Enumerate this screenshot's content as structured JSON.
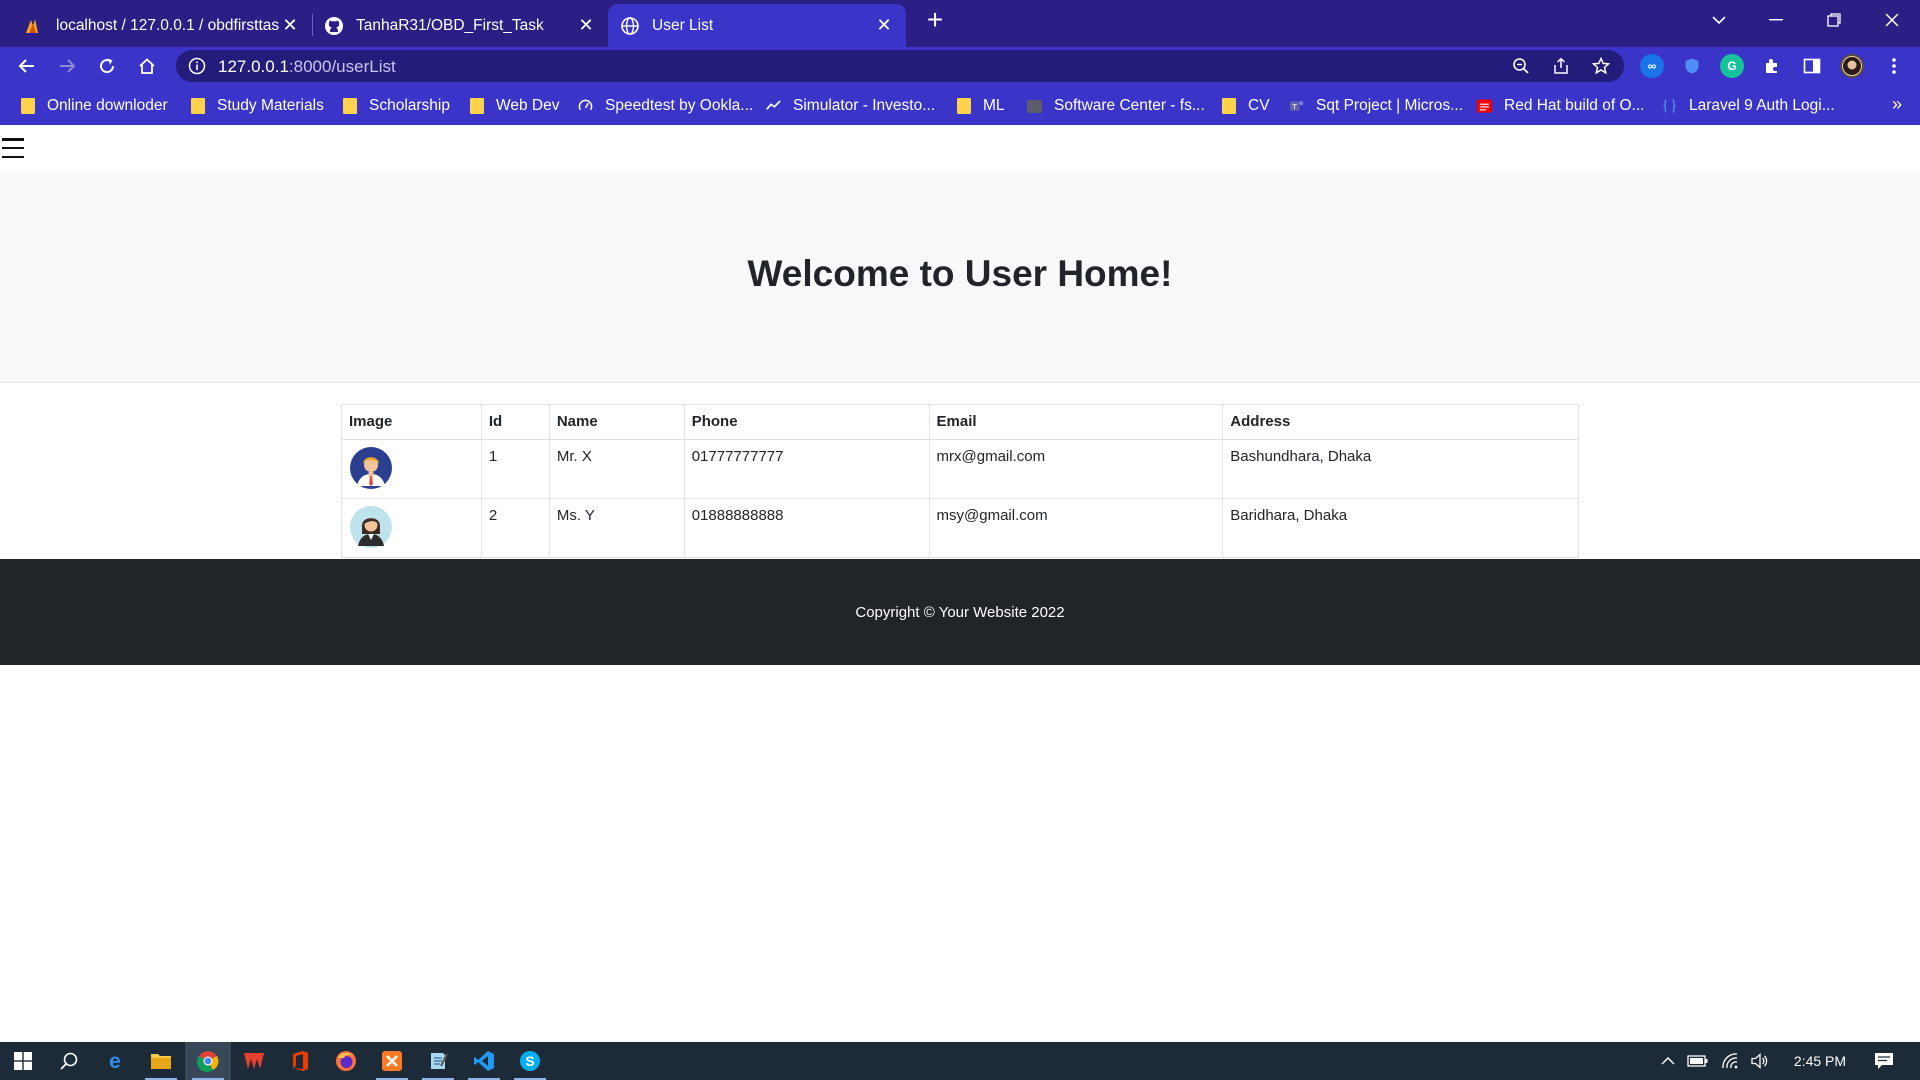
{
  "browser": {
    "tabs": [
      {
        "title": "localhost / 127.0.0.1 / obdfirsttas",
        "icon": "phpmyadmin-icon",
        "active": false
      },
      {
        "title": "TanhaR31/OBD_First_Task",
        "icon": "github-icon",
        "active": false
      },
      {
        "title": "User List",
        "icon": "globe-icon",
        "active": true
      }
    ],
    "url": {
      "host": "127.0.0.1",
      "path": ":8000/userList"
    },
    "bookmarks": [
      {
        "label": "Online downloder",
        "icon": "folder-icon"
      },
      {
        "label": "Study Materials",
        "icon": "folder-icon"
      },
      {
        "label": "Scholarship",
        "icon": "folder-icon"
      },
      {
        "label": "Web Dev",
        "icon": "folder-icon"
      },
      {
        "label": "Speedtest by Ookla...",
        "icon": "speedtest-icon"
      },
      {
        "label": "Simulator - Investo...",
        "icon": "investopedia-icon"
      },
      {
        "label": "ML",
        "icon": "folder-icon"
      },
      {
        "label": "Software Center - fs...",
        "icon": "folder-icon"
      },
      {
        "label": "CV",
        "icon": "folder-icon"
      },
      {
        "label": "Sqt Project | Micros...",
        "icon": "teams-icon"
      },
      {
        "label": "Red Hat build of O...",
        "icon": "redhat-icon"
      },
      {
        "label": "Laravel 9 Auth Logi...",
        "icon": "brackets-icon"
      }
    ]
  },
  "page": {
    "heading": "Welcome to User Home!",
    "table": {
      "columns": [
        "Image",
        "Id",
        "Name",
        "Phone",
        "Email",
        "Address"
      ],
      "rows": [
        {
          "image": "male-avatar",
          "id": "1",
          "name": "Mr. X",
          "phone": "01777777777",
          "email": "mrx@gmail.com",
          "address": "Bashundhara, Dhaka"
        },
        {
          "image": "female-avatar",
          "id": "2",
          "name": "Ms. Y",
          "phone": "01888888888",
          "email": "msy@gmail.com",
          "address": "Baridhara, Dhaka"
        }
      ]
    },
    "footer": "Copyright © Your Website 2022"
  },
  "taskbar": {
    "apps": [
      "windows-start-icon",
      "search-icon",
      "edge-icon",
      "file-explorer-icon",
      "chrome-icon",
      "wps-office-icon",
      "office-icon",
      "firefox-icon",
      "xampp-icon",
      "notepad-icon",
      "vscode-icon",
      "skype-icon"
    ],
    "time": "2:45 PM"
  },
  "colors": {
    "tabstrip": "#2b1f86",
    "toolbar": "#3a35c8",
    "hero_bg": "#f8f9fa",
    "footer_bg": "#212529",
    "taskbar_bg": "#1d2a38"
  }
}
